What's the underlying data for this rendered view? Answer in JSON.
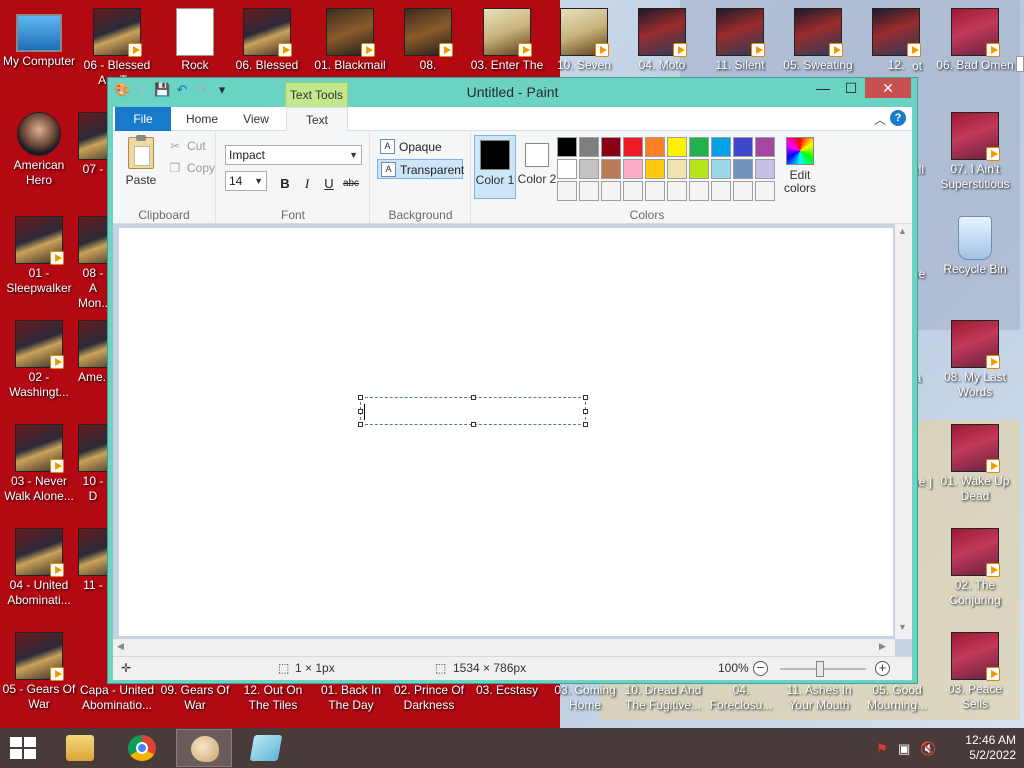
{
  "desktop": {
    "icons": [
      {
        "label": "My Computer",
        "type": "pc"
      },
      {
        "label": "06 - Blessed Are T...",
        "type": "cover"
      },
      {
        "label": "Rock",
        "type": "file"
      },
      {
        "label": "06. Blessed",
        "type": "cover"
      },
      {
        "label": "01. Blackmail",
        "type": "cover2"
      },
      {
        "label": "08.",
        "type": "cover2"
      },
      {
        "label": "03. Enter The",
        "type": "cover3"
      },
      {
        "label": "10. Seven",
        "type": "cover3"
      },
      {
        "label": "04. Moto",
        "type": "cover4"
      },
      {
        "label": "11. Silent",
        "type": "cover4"
      },
      {
        "label": "05. Sweating",
        "type": "cover4"
      },
      {
        "label": "12.",
        "type": "cover4"
      },
      {
        "label": "06. Bad Omen",
        "type": "cover5"
      },
      {
        "label": "American Hero",
        "type": "avatar"
      },
      {
        "label": "07 -",
        "type": "cover"
      },
      {
        "label": "01 - Sleepwalker",
        "type": "cover"
      },
      {
        "label": "08 - A Mon...",
        "type": "cover"
      },
      {
        "label": "02 - Washingt...",
        "type": "cover"
      },
      {
        "label": "Ame...",
        "type": "cover"
      },
      {
        "label": "03 - Never Walk Alone...",
        "type": "cover"
      },
      {
        "label": "10 - D",
        "type": "cover"
      },
      {
        "label": "04 - United Abominati...",
        "type": "cover"
      },
      {
        "label": "11 -",
        "type": "cover"
      },
      {
        "label": "05 - Gears Of War",
        "type": "cover"
      },
      {
        "label": "Capa - United Abominatio...",
        "type": "cover"
      },
      {
        "label": "09. Gears Of War",
        "type": "cover"
      },
      {
        "label": "12. Out On The Tiles",
        "type": "cover"
      },
      {
        "label": "01. Back In The Day",
        "type": "cover"
      },
      {
        "label": "02. Prince Of Darkness",
        "type": "cover"
      },
      {
        "label": "03. Ecstasy",
        "type": "cover"
      },
      {
        "label": "03. Coming Home",
        "type": "cover"
      },
      {
        "label": "10. Dread And The Fugitive...",
        "type": "cover"
      },
      {
        "label": "04. Foreclosu...",
        "type": "cover"
      },
      {
        "label": "11. Ashes In Your Mouth",
        "type": "cover"
      },
      {
        "label": "05. Good Mourning...",
        "type": "cover"
      },
      {
        "label": "03. Peace Sells",
        "type": "cover5"
      },
      {
        "label": "07. I Ain't Superstitious",
        "type": "cover5"
      },
      {
        "label": "Recycle Bin",
        "type": "bin"
      },
      {
        "label": "08. My Last Words",
        "type": "cover5"
      },
      {
        "label": "01. Wake Up Dead",
        "type": "cover5"
      },
      {
        "label": "02. The Conjuring",
        "type": "cover5"
      },
      {
        "label": "ell",
        "type": "none"
      },
      {
        "label": "ne",
        "type": "none"
      },
      {
        "label": "ia",
        "type": "none"
      },
      {
        "label": "ne ]",
        "type": "none"
      },
      {
        "label": "ot",
        "type": "none"
      }
    ]
  },
  "window": {
    "title": "Untitled - Paint",
    "contextual_tab": "Text Tools",
    "min_glyph": "—",
    "max_glyph": "☐",
    "close_glyph": "✕"
  },
  "ribbon": {
    "tabs": {
      "file": "File",
      "home": "Home",
      "view": "View",
      "text": "Text"
    },
    "help": "?",
    "collapse": "︿",
    "clipboard": {
      "label": "Clipboard",
      "paste": "Paste",
      "cut": "Cut",
      "copy": "Copy"
    },
    "font": {
      "label": "Font",
      "family": "Impact",
      "size": "14",
      "bold": "B",
      "italic": "I",
      "underline": "U",
      "strike": "abc"
    },
    "background": {
      "label": "Background",
      "opaque": "Opaque",
      "transparent": "Transparent",
      "selected": "Transparent"
    },
    "colors": {
      "label": "Colors",
      "color1": "Color 1",
      "color2": "Color 2",
      "color1_value": "#000000",
      "color2_value": "#ffffff",
      "edit": "Edit colors",
      "palette": [
        "#000000",
        "#7f7f7f",
        "#880015",
        "#ed1c24",
        "#ff7f27",
        "#fff200",
        "#22b14c",
        "#00a2e8",
        "#3f48cc",
        "#a349a4",
        "#ffffff",
        "#c3c3c3",
        "#b97a57",
        "#ffaec9",
        "#ffc90e",
        "#efe4b0",
        "#b5e61d",
        "#99d9ea",
        "#7092be",
        "#c8bfe7",
        "#f4f4f4",
        "#f4f4f4",
        "#f4f4f4",
        "#f4f4f4",
        "#f4f4f4",
        "#f4f4f4",
        "#f4f4f4",
        "#f4f4f4",
        "#f4f4f4",
        "#f4f4f4"
      ]
    }
  },
  "status": {
    "selection_size": "1 × 1px",
    "image_size": "1534 × 786px",
    "zoom": "100%",
    "zoom_level_percent": 100
  },
  "taskbar": {
    "apps": [
      {
        "name": "file-explorer",
        "active": false
      },
      {
        "name": "chrome",
        "active": false
      },
      {
        "name": "paint",
        "active": true
      },
      {
        "name": "notepad",
        "active": false
      }
    ],
    "time": "12:46 AM",
    "date": "5/2/2022"
  }
}
